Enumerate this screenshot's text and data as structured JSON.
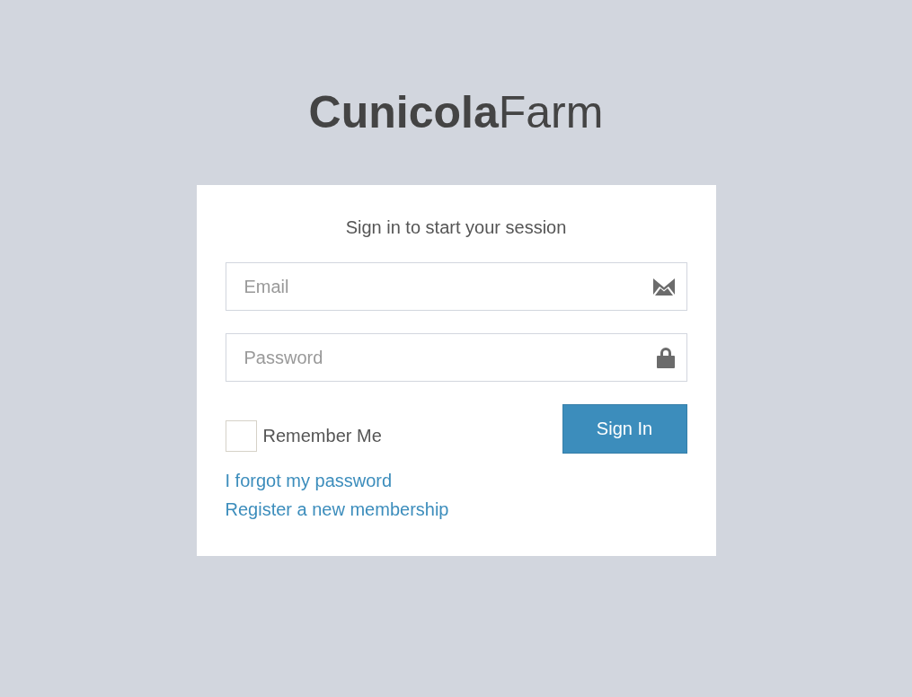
{
  "logo": "**Cunicola**Farm",
  "login_box": {
    "message": "Sign in to start your session",
    "fields": [
      {
        "kind": "email",
        "placeholder": "Email"
      },
      {
        "kind": "password",
        "placeholder": "Password"
      }
    ],
    "remember_me": {
      "label": "Remember Me",
      "checked": false
    },
    "sign_in_button": "Sign In",
    "links": [
      "I forgot my password",
      "Register a new membership"
    ]
  }
}
